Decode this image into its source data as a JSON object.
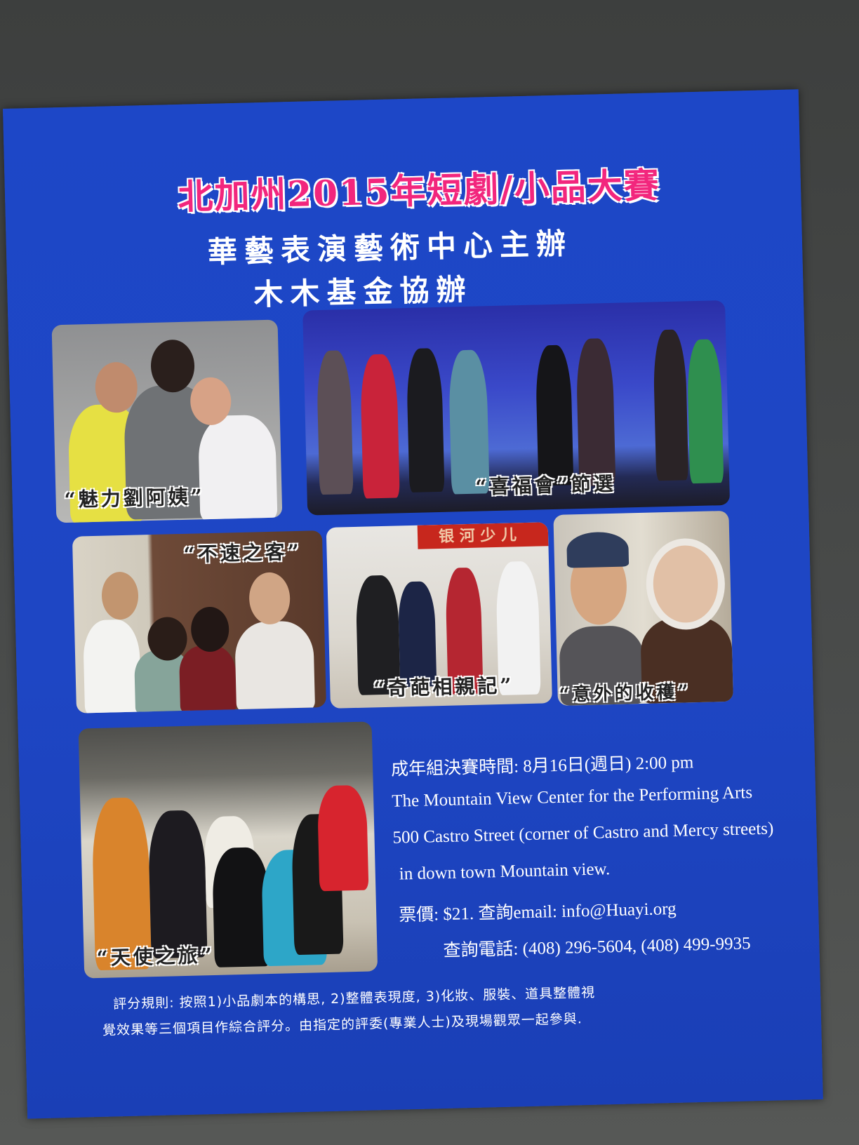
{
  "poster": {
    "title": "北加州2015年短劇/小品大賽",
    "organizer": "華藝表演藝術中心主辦",
    "co_organizer": "木木基金協辦"
  },
  "captions": {
    "photo1": "“魅力劉阿姨”",
    "photo2": "“喜福會”節選",
    "photo3": "“不速之客”",
    "photo4": "“奇葩相親記”",
    "photo4_sign": "银 河 少 儿",
    "photo5": "“意外的收穫”",
    "photo6": "“天使之旅”"
  },
  "event": {
    "schedule": "成年組決賽時間:  8月16日(週日) 2:00 pm",
    "venue": "The Mountain View Center for the Performing Arts",
    "address": "500 Castro Street (corner of Castro and Mercy streets)",
    "area": "in down town Mountain view.",
    "ticket": "票價:  $21. 查詢email: info@Huayi.org",
    "phone": "查詢電話: (408) 296-5604, (408) 499-9935"
  },
  "rules": {
    "line1": "評分規則: 按照1)小品劇本的構思, 2)整體表現度, 3)化妝、服裝、道具整體視",
    "line2": "覺效果等三個項目作綜合評分。由指定的評委(專業人士)及現場觀眾一起參與."
  },
  "colors": {
    "poster_bg": "#1d47c7",
    "title_pink": "#f2267d",
    "text_white": "#ffffff"
  }
}
